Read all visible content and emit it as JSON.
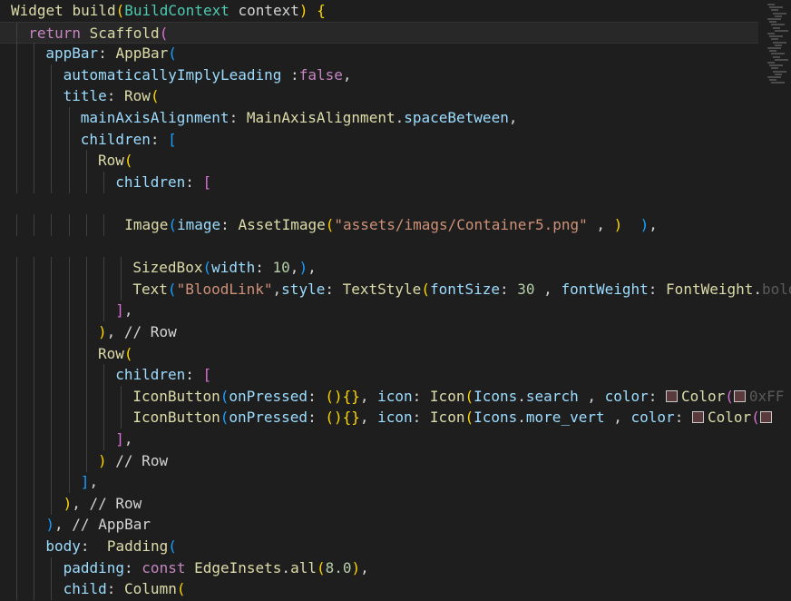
{
  "theme": {
    "background": "#1e1e1e",
    "current_line": "#282828",
    "swatch_color": "#5a3a3a"
  },
  "code_lines": [
    {
      "indent": 0,
      "current": false,
      "tokens": [
        [
          "fn",
          "Widget "
        ],
        [
          "fn",
          "build"
        ],
        [
          "b1",
          "("
        ],
        [
          "cls",
          "BuildContext"
        ],
        [
          "txt",
          " context"
        ],
        [
          "b1",
          ")"
        ],
        [
          "txt",
          " "
        ],
        [
          "b1",
          "{"
        ]
      ]
    },
    {
      "indent": 1,
      "current": true,
      "tokens": [
        [
          "kw",
          "return "
        ],
        [
          "fn",
          "Scaffold"
        ],
        [
          "b2",
          "("
        ]
      ]
    },
    {
      "indent": 2,
      "current": false,
      "tokens": [
        [
          "id",
          "appBar"
        ],
        [
          "txt",
          ": "
        ],
        [
          "fn",
          "AppBar"
        ],
        [
          "b3",
          "("
        ]
      ]
    },
    {
      "indent": 3,
      "current": false,
      "tokens": [
        [
          "id",
          "automaticallyImplyLeading"
        ],
        [
          "txt",
          " :"
        ],
        [
          "kw",
          "false"
        ],
        [
          "txt",
          ","
        ]
      ]
    },
    {
      "indent": 3,
      "current": false,
      "tokens": [
        [
          "id",
          "title"
        ],
        [
          "txt",
          ": "
        ],
        [
          "fn",
          "Row"
        ],
        [
          "b1",
          "("
        ]
      ]
    },
    {
      "indent": 4,
      "current": false,
      "tokens": [
        [
          "id",
          "mainAxisAlignment"
        ],
        [
          "txt",
          ": "
        ],
        [
          "fn",
          "MainAxisAlignment"
        ],
        [
          "txt",
          "."
        ],
        [
          "id",
          "spaceBetween"
        ],
        [
          "txt",
          ","
        ]
      ]
    },
    {
      "indent": 4,
      "current": false,
      "tokens": [
        [
          "id",
          "children"
        ],
        [
          "txt",
          ": "
        ],
        [
          "b3",
          "["
        ]
      ]
    },
    {
      "indent": 5,
      "current": false,
      "tokens": [
        [
          "fn",
          "Row"
        ],
        [
          "b1",
          "("
        ]
      ]
    },
    {
      "indent": 6,
      "current": false,
      "tokens": [
        [
          "id",
          "children"
        ],
        [
          "txt",
          ": "
        ],
        [
          "b2",
          "["
        ]
      ]
    },
    {
      "indent": 0,
      "current": false,
      "tokens": []
    },
    {
      "indent": 6,
      "current": false,
      "pad": 10,
      "tokens": [
        [
          "fn",
          "Image"
        ],
        [
          "b3",
          "("
        ],
        [
          "id",
          "image"
        ],
        [
          "txt",
          ": "
        ],
        [
          "fn",
          "AssetImage"
        ],
        [
          "b1",
          "("
        ],
        [
          "str",
          "\"assets/imags/Container5.png\""
        ],
        [
          "txt",
          " , "
        ],
        [
          "b1",
          ")"
        ],
        [
          "txt",
          "  "
        ],
        [
          "b3",
          ")"
        ],
        [
          "txt",
          ","
        ]
      ]
    },
    {
      "indent": 0,
      "current": false,
      "tokens": []
    },
    {
      "indent": 7,
      "current": false,
      "tokens": [
        [
          "fn",
          "SizedBox"
        ],
        [
          "b3",
          "("
        ],
        [
          "id",
          "width"
        ],
        [
          "txt",
          ": "
        ],
        [
          "num",
          "10"
        ],
        [
          "txt",
          ","
        ],
        [
          "b3",
          ")"
        ],
        [
          "txt",
          ","
        ]
      ]
    },
    {
      "indent": 7,
      "current": false,
      "tokens": [
        [
          "fn",
          "Text"
        ],
        [
          "b3",
          "("
        ],
        [
          "str",
          "\"BloodLink\""
        ],
        [
          "txt",
          ","
        ],
        [
          "id",
          "style"
        ],
        [
          "txt",
          ": "
        ],
        [
          "fn",
          "TextStyle"
        ],
        [
          "b1",
          "("
        ],
        [
          "id",
          "fontSize"
        ],
        [
          "txt",
          ": "
        ],
        [
          "num",
          "30"
        ],
        [
          "txt",
          " , "
        ],
        [
          "id",
          "fontWeight"
        ],
        [
          "txt",
          ": "
        ],
        [
          "fn",
          "FontWeight"
        ],
        [
          "txt",
          "."
        ],
        [
          "dim",
          "bold"
        ]
      ]
    },
    {
      "indent": 6,
      "current": false,
      "tokens": [
        [
          "b2",
          "]"
        ],
        [
          "txt",
          ","
        ]
      ]
    },
    {
      "indent": 5,
      "current": false,
      "tokens": [
        [
          "b1",
          ")"
        ],
        [
          "txt",
          ", "
        ],
        [
          "cmt",
          "// Row"
        ]
      ]
    },
    {
      "indent": 5,
      "current": false,
      "tokens": [
        [
          "fn",
          "Row"
        ],
        [
          "b1",
          "("
        ]
      ]
    },
    {
      "indent": 6,
      "current": false,
      "tokens": [
        [
          "id",
          "children"
        ],
        [
          "txt",
          ": "
        ],
        [
          "b2",
          "["
        ]
      ]
    },
    {
      "indent": 7,
      "current": false,
      "tokens": [
        [
          "fn",
          "IconButton"
        ],
        [
          "b3",
          "("
        ],
        [
          "id",
          "onPressed"
        ],
        [
          "txt",
          ": "
        ],
        [
          "b1",
          "()"
        ],
        [
          "b1",
          "{}"
        ],
        [
          "txt",
          ", "
        ],
        [
          "id",
          "icon"
        ],
        [
          "txt",
          ": "
        ],
        [
          "fn",
          "Icon"
        ],
        [
          "b1",
          "("
        ],
        [
          "id",
          "Icons"
        ],
        [
          "txt",
          "."
        ],
        [
          "id",
          "search"
        ],
        [
          "txt",
          " , "
        ],
        [
          "id",
          "color"
        ],
        [
          "txt",
          ": "
        ],
        [
          "swatch",
          ""
        ],
        [
          "fn",
          "Color"
        ],
        [
          "b2",
          "("
        ],
        [
          "swatch",
          ""
        ],
        [
          "dim",
          "0xFF"
        ]
      ]
    },
    {
      "indent": 7,
      "current": false,
      "tokens": [
        [
          "fn",
          "IconButton"
        ],
        [
          "b3",
          "("
        ],
        [
          "id",
          "onPressed"
        ],
        [
          "txt",
          ": "
        ],
        [
          "b1",
          "()"
        ],
        [
          "b1",
          "{}"
        ],
        [
          "txt",
          ", "
        ],
        [
          "id",
          "icon"
        ],
        [
          "txt",
          ": "
        ],
        [
          "fn",
          "Icon"
        ],
        [
          "b1",
          "("
        ],
        [
          "id",
          "Icons"
        ],
        [
          "txt",
          "."
        ],
        [
          "id",
          "more_vert"
        ],
        [
          "txt",
          " , "
        ],
        [
          "id",
          "color"
        ],
        [
          "txt",
          ": "
        ],
        [
          "swatch",
          ""
        ],
        [
          "fn",
          "Color"
        ],
        [
          "b2",
          "("
        ],
        [
          "swatch",
          ""
        ]
      ]
    },
    {
      "indent": 6,
      "current": false,
      "tokens": [
        [
          "b2",
          "]"
        ],
        [
          "txt",
          ","
        ]
      ]
    },
    {
      "indent": 5,
      "current": false,
      "tokens": [
        [
          "b1",
          ")"
        ],
        [
          "txt",
          " "
        ],
        [
          "cmt",
          "// Row"
        ]
      ]
    },
    {
      "indent": 4,
      "current": false,
      "tokens": [
        [
          "b3",
          "]"
        ],
        [
          "txt",
          ","
        ]
      ]
    },
    {
      "indent": 3,
      "current": false,
      "tokens": [
        [
          "b1",
          ")"
        ],
        [
          "txt",
          ", "
        ],
        [
          "cmt",
          "// Row"
        ]
      ]
    },
    {
      "indent": 2,
      "current": false,
      "tokens": [
        [
          "b3",
          ")"
        ],
        [
          "txt",
          ", "
        ],
        [
          "cmt",
          "// AppBar"
        ]
      ]
    },
    {
      "indent": 2,
      "current": false,
      "tokens": [
        [
          "id",
          "body"
        ],
        [
          "txt",
          ":  "
        ],
        [
          "fn",
          "Padding"
        ],
        [
          "b3",
          "("
        ]
      ]
    },
    {
      "indent": 3,
      "current": false,
      "tokens": [
        [
          "id",
          "padding"
        ],
        [
          "txt",
          ": "
        ],
        [
          "kw",
          "const "
        ],
        [
          "fn",
          "EdgeInsets"
        ],
        [
          "txt",
          "."
        ],
        [
          "fn",
          "all"
        ],
        [
          "b1",
          "("
        ],
        [
          "num",
          "8.0"
        ],
        [
          "b1",
          ")"
        ],
        [
          "txt",
          ","
        ]
      ]
    },
    {
      "indent": 3,
      "current": false,
      "tokens": [
        [
          "id",
          "child"
        ],
        [
          "txt",
          ": "
        ],
        [
          "fn",
          "Column"
        ],
        [
          "b1",
          "("
        ]
      ]
    }
  ]
}
